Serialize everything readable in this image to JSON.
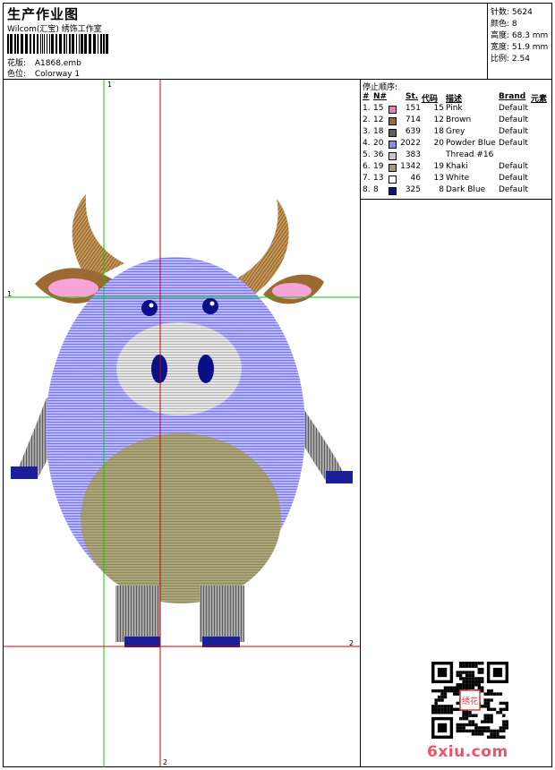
{
  "header": {
    "title": "生产作业图",
    "company": "Wilcom(汇宝) 绣饰工作室",
    "design_label": "花版:",
    "design_value": "A1868.emb",
    "colorway_label": "色位:",
    "colorway_value": "Colorway 1"
  },
  "stats": {
    "stitches": "针数: 5624",
    "colors": "颜色: 8",
    "height": "高度: 68.3 mm",
    "width": "宽度: 51.9 mm",
    "scale": "比例: 2.54"
  },
  "guides": {
    "v1_top": "1",
    "h1_left": "1",
    "h2_right": "2",
    "v2_bottom": "2"
  },
  "color_table": {
    "title": "停止顺序:",
    "headers": {
      "num": "#",
      "n": "N#",
      "st": "St.",
      "code": "代码",
      "desc": "描述",
      "brand": "Brand",
      "element": "元素"
    },
    "rows": [
      {
        "num": "1.",
        "n": "15",
        "st": "151",
        "code": "15",
        "desc": "Pink",
        "brand": "Default",
        "color": "#f07ac8"
      },
      {
        "num": "2.",
        "n": "12",
        "st": "714",
        "code": "12",
        "desc": "Brown",
        "brand": "Default",
        "color": "#9b6a33"
      },
      {
        "num": "3.",
        "n": "18",
        "st": "639",
        "code": "18",
        "desc": "Grey",
        "brand": "Default",
        "color": "#5d5d5d"
      },
      {
        "num": "4.",
        "n": "20",
        "st": "2022",
        "code": "20",
        "desc": "Powder Blue",
        "brand": "Default",
        "color": "#8a89f0"
      },
      {
        "num": "5.",
        "n": "36",
        "st": "383",
        "code": "",
        "desc": "Thread #16",
        "brand": "",
        "color": "#c8c8c8"
      },
      {
        "num": "6.",
        "n": "19",
        "st": "1342",
        "code": "19",
        "desc": "Khaki",
        "brand": "Default",
        "color": "#a19b6e"
      },
      {
        "num": "7.",
        "n": "13",
        "st": "46",
        "code": "13",
        "desc": "White",
        "brand": "Default",
        "color": "#ffffff"
      },
      {
        "num": "8.",
        "n": "8",
        "st": "325",
        "code": "8",
        "desc": "Dark Blue",
        "brand": "Default",
        "color": "#0a108a"
      }
    ]
  },
  "watermark": "6xiu.com",
  "qr_badge": "绣花"
}
